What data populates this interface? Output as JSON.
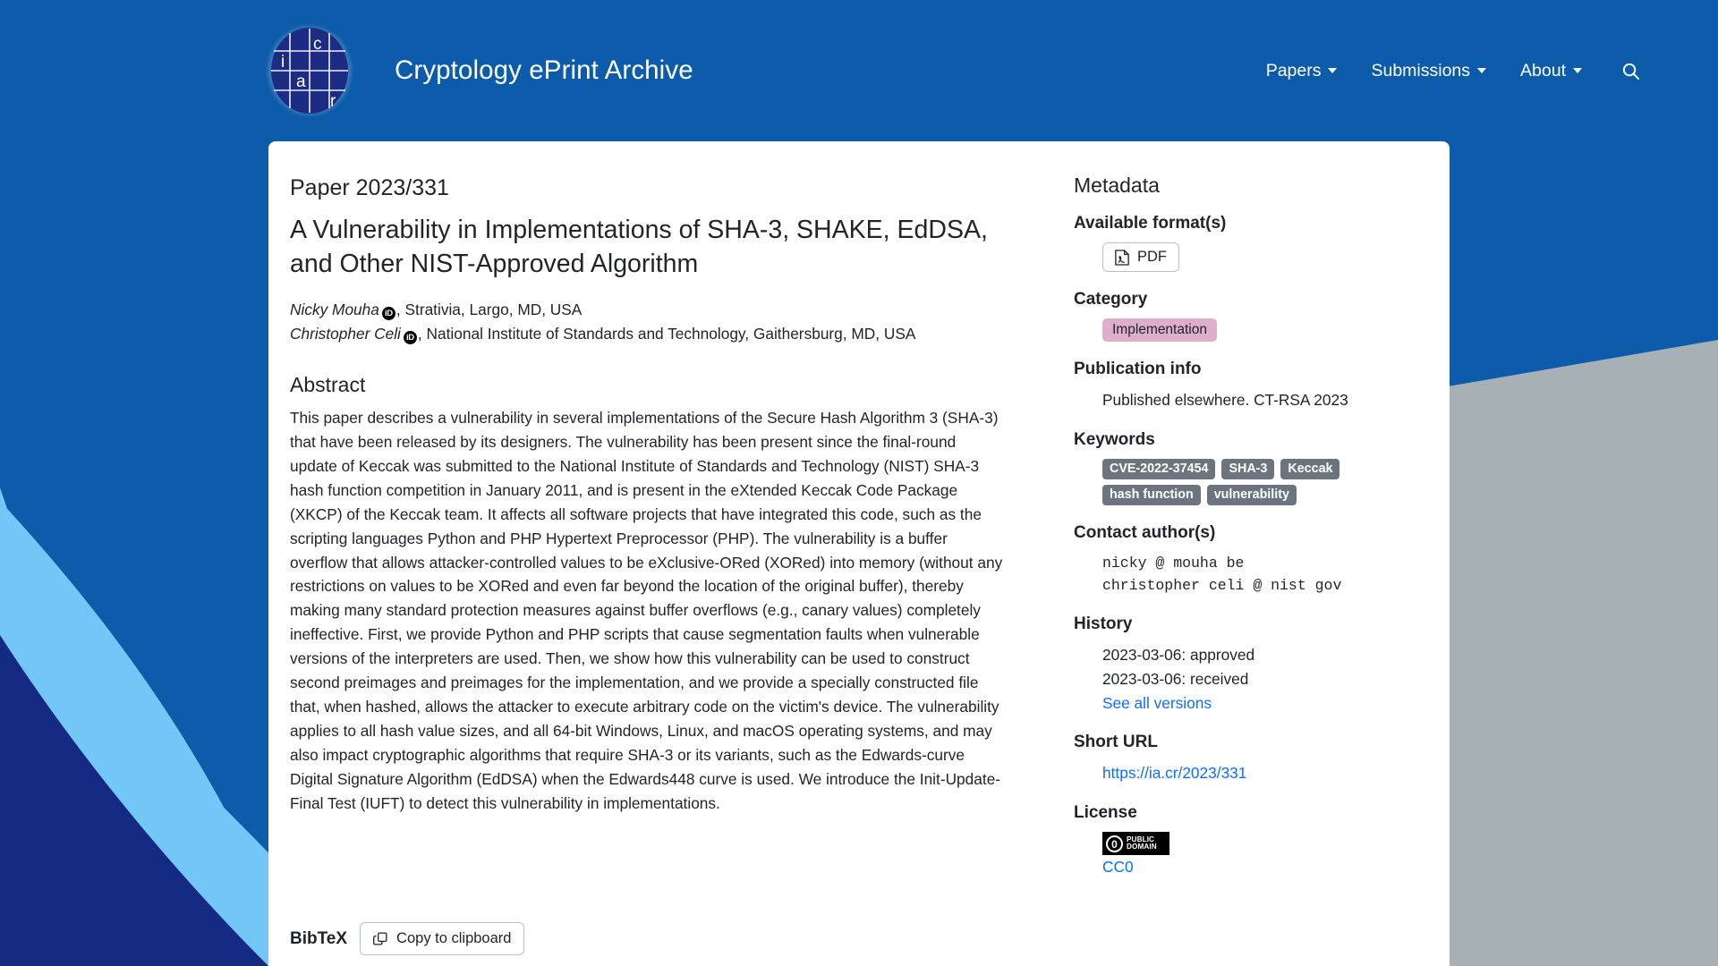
{
  "header": {
    "brand_title": "Cryptology ePrint Archive",
    "logo_letters": [
      "i",
      "a",
      "c",
      "r"
    ],
    "nav": [
      {
        "label": "Papers",
        "icon": "chevron-down-icon"
      },
      {
        "label": "Submissions",
        "icon": "chevron-down-icon"
      },
      {
        "label": "About",
        "icon": "chevron-down-icon"
      }
    ],
    "search_icon": "search-icon"
  },
  "paper": {
    "id_label": "Paper 2023/331",
    "title": "A Vulnerability in Implementations of SHA-3, SHAKE, EdDSA, and Other NIST-Approved Algorithm",
    "authors": [
      {
        "name": "Nicky Mouha",
        "orcid_icon": "orcid-id-icon",
        "orcid_label": "iD",
        "affiliation": ", Strativia, Largo, MD, USA"
      },
      {
        "name": "Christopher Celi",
        "orcid_icon": "orcid-id-icon",
        "orcid_label": "iD",
        "affiliation": ", National Institute of Standards and Technology, Gaithersburg, MD, USA"
      }
    ],
    "abstract_heading": "Abstract",
    "abstract": "This paper describes a vulnerability in several implementations of the Secure Hash Algorithm 3 (SHA-3) that have been released by its designers. The vulnerability has been present since the final-round update of Keccak was submitted to the National Institute of Standards and Technology (NIST) SHA-3 hash function competition in January 2011, and is present in the eXtended Keccak Code Package (XKCP) of the Keccak team. It affects all software projects that have integrated this code, such as the scripting languages Python and PHP Hypertext Preprocessor (PHP). The vulnerability is a buffer overflow that allows attacker-controlled values to be eXclusive-ORed (XORed) into memory (without any restrictions on values to be XORed and even far beyond the location of the original buffer), thereby making many standard protection measures against buffer overflows (e.g., canary values) completely ineffective. First, we provide Python and PHP scripts that cause segmentation faults when vulnerable versions of the interpreters are used. Then, we show how this vulnerability can be used to construct second preimages and preimages for the implementation, and we provide a specially constructed file that, when hashed, allows the attacker to execute arbitrary code on the victim's device. The vulnerability applies to all hash value sizes, and all 64-bit Windows, Linux, and macOS operating systems, and may also impact cryptographic algorithms that require SHA-3 or its variants, such as the Edwards-curve Digital Signature Algorithm (EdDSA) when the Edwards448 curve is used. We introduce the Init-Update-Final Test (IUFT) to detect this vulnerability in implementations.",
    "bibtex_label": "BibTeX",
    "copy_button_label": "Copy to clipboard",
    "copy_button_icon": "copy-icon"
  },
  "metadata": {
    "title": "Metadata",
    "formats": {
      "heading": "Available format(s)",
      "items": [
        {
          "label": "PDF",
          "icon": "pdf-file-icon"
        }
      ]
    },
    "category": {
      "heading": "Category",
      "value": "Implementation",
      "color": "#ddafcd"
    },
    "publication_info": {
      "heading": "Publication info",
      "value": "Published elsewhere. CT-RSA 2023"
    },
    "keywords": {
      "heading": "Keywords",
      "items": [
        "CVE-2022-37454",
        "SHA-3",
        "Keccak",
        "hash function",
        "vulnerability"
      ],
      "color": "#6c757d"
    },
    "contact_authors": {
      "heading": "Contact author(s)",
      "items": [
        "nicky @ mouha be",
        "christopher celi @ nist gov"
      ]
    },
    "history": {
      "heading": "History",
      "entries": [
        "2023-03-06: approved",
        "2023-03-06: received"
      ],
      "see_all_label": "See all versions"
    },
    "short_url": {
      "heading": "Short URL",
      "value": "https://ia.cr/2023/331"
    },
    "license": {
      "heading": "License",
      "badge_line1": "PUBLIC",
      "badge_line2": "DOMAIN",
      "badge_symbol": "0",
      "link_label": "CC0"
    }
  },
  "theme": {
    "header_blue": "#0d5cab",
    "light_blue": "#72c7f7",
    "navy": "#142a83",
    "gray": "#a7b0b4",
    "link_blue": "#0d6efd",
    "text": "#212529"
  }
}
